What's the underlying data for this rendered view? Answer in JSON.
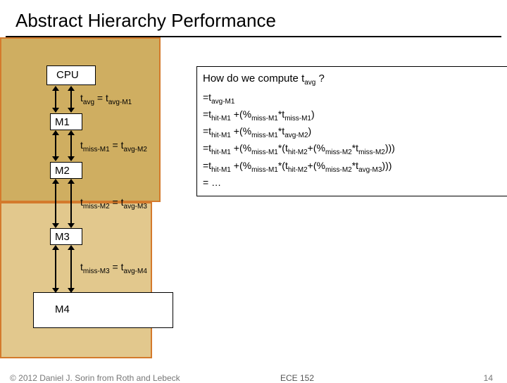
{
  "title": "Abstract Hierarchy Performance",
  "hierarchy": {
    "cpu": "CPU",
    "m1": "M1",
    "m2": "M2",
    "m3": "M3",
    "m4": "M4"
  },
  "edge_eq": {
    "e1": {
      "lhs": "avg",
      "rhs": "avg-M1"
    },
    "e2": {
      "lhs": "miss-M1",
      "rhs": "avg-M2"
    },
    "e3": {
      "lhs": "miss-M2",
      "rhs": "avg-M3"
    },
    "e4": {
      "lhs": "miss-M3",
      "rhs": "avg-M4"
    }
  },
  "callout": {
    "heading_prefix": "How do we compute t",
    "heading_sub": "avg",
    "heading_suffix": " ?",
    "lines": [
      {
        "pre": "=t",
        "s1": "avg-M1",
        "rest": ""
      },
      {
        "pre": "=t",
        "s1": "hit-M1",
        "mid1": " +(%",
        "s2": "miss-M1",
        "mid2": "*t",
        "s3": "miss-M1",
        "end": ")"
      },
      {
        "pre": "=t",
        "s1": "hit-M1",
        "mid1": " +(%",
        "s2": "miss-M1",
        "mid2": "*t",
        "s3": "avg-M2",
        "end": ")"
      },
      {
        "pre": "=t",
        "s1": "hit-M1",
        "mid1": " +(%",
        "s2": "miss-M1",
        "mid2": "*(t",
        "s3": "hit-M2",
        "mid3": "+(%",
        "s4": "miss-M2",
        "mid4": "*t",
        "s5": "miss-M2",
        "end": ")))"
      },
      {
        "pre": "=t",
        "s1": "hit-M1",
        "mid1": " +(%",
        "s2": "miss-M1",
        "mid2": "*(t",
        "s3": "hit-M2",
        "mid3": "+(%",
        "s4": "miss-M2",
        "mid4": "*t",
        "s5": "avg-M3",
        "end": ")))"
      },
      {
        "pre": "= …",
        "s1": "",
        "rest": ""
      }
    ]
  },
  "footer": {
    "copyright": "© 2012 Daniel J. Sorin from Roth and Lebeck",
    "course": "ECE 152",
    "page": "14"
  }
}
